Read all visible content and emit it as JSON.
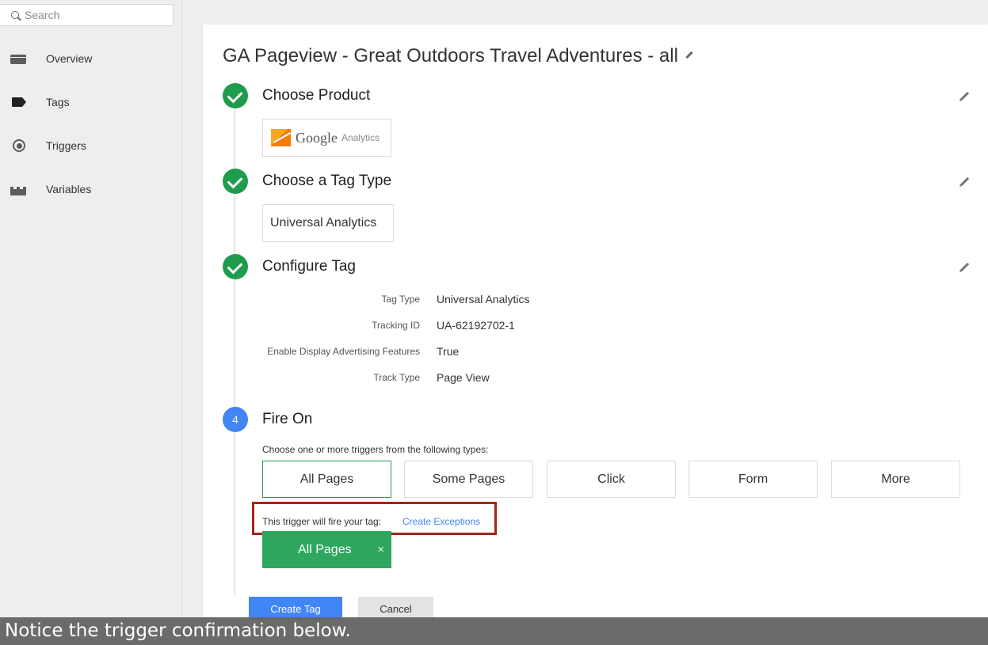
{
  "search": {
    "placeholder": "Search"
  },
  "sidebar": {
    "items": [
      {
        "label": "Overview",
        "icon": "overview-icon"
      },
      {
        "label": "Tags",
        "icon": "tag-icon"
      },
      {
        "label": "Triggers",
        "icon": "trigger-icon"
      },
      {
        "label": "Variables",
        "icon": "variables-icon"
      }
    ]
  },
  "main": {
    "title": "GA Pageview - Great Outdoors Travel Adventures - all",
    "steps": [
      {
        "title": "Choose Product",
        "product": {
          "brand": "Google",
          "sub": "Analytics"
        }
      },
      {
        "title": "Choose a Tag Type",
        "tag_type": "Universal Analytics"
      },
      {
        "title": "Configure Tag",
        "config": [
          {
            "label": "Tag Type",
            "value": "Universal Analytics"
          },
          {
            "label": "Tracking ID",
            "value": "UA-62192702-1"
          },
          {
            "label": "Enable Display Advertising Features",
            "value": "True"
          },
          {
            "label": "Track Type",
            "value": "Page View"
          }
        ]
      },
      {
        "number": "4",
        "title": "Fire On"
      }
    ],
    "fire_on": {
      "instructions": "Choose one or more triggers from the following types:",
      "trigger_types": [
        "All Pages",
        "Some Pages",
        "Click",
        "Form",
        "More"
      ],
      "fire_text": "This trigger will fire your tag:",
      "exceptions_link": "Create Exceptions",
      "selected_trigger": "All Pages",
      "remove_symbol": "×"
    },
    "actions": {
      "create": "Create Tag",
      "cancel": "Cancel"
    }
  },
  "caption": "Notice the trigger confirmation below.",
  "colors": {
    "accent_green": "#1e9c4d",
    "accent_blue": "#4285f4",
    "highlight": "#a0261b"
  }
}
